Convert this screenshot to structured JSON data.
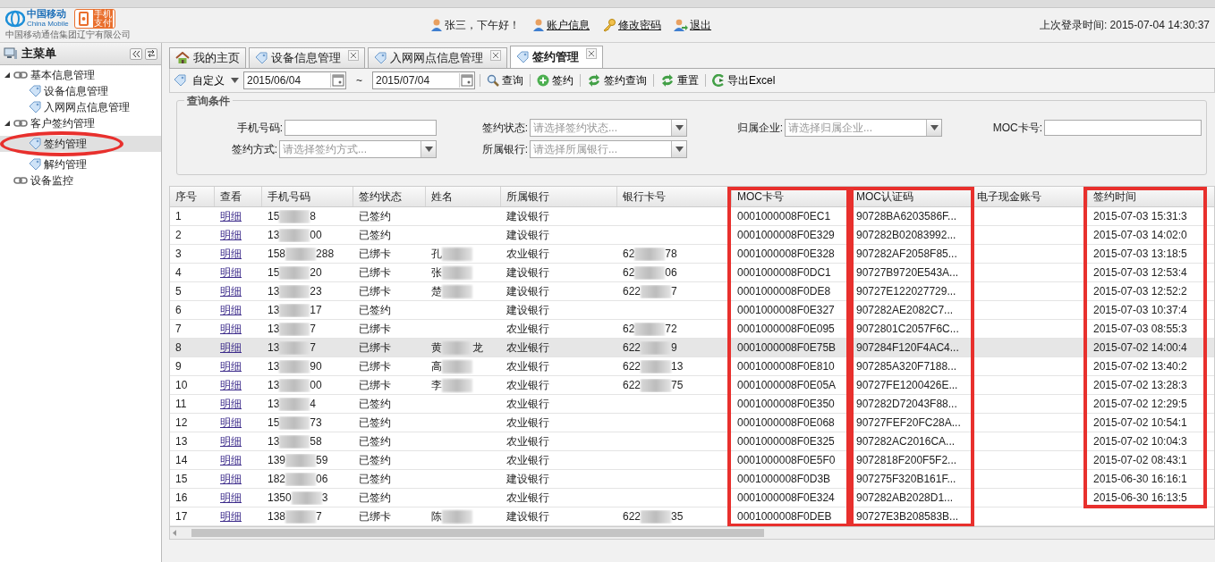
{
  "header": {
    "logo_cn": "中国移动",
    "logo_en": "China Mobile",
    "company": "中国移动通信集团辽宁有限公司",
    "pay_logo": "手机支付",
    "greeting": "张三，下午好！",
    "links": [
      "账户信息",
      "修改密码",
      "退出"
    ],
    "last_login": "上次登录时间: 2015-07-04 14:30:37"
  },
  "sidebar": {
    "title": "主菜单",
    "tree": [
      {
        "label": "基本信息管理",
        "expanded": true,
        "children": [
          {
            "label": "设备信息管理",
            "selected": false,
            "circled": false
          },
          {
            "label": "入网网点信息管理",
            "selected": false,
            "circled": false
          }
        ]
      },
      {
        "label": "客户签约管理",
        "expanded": true,
        "children": [
          {
            "label": "签约管理",
            "selected": true,
            "circled": true
          },
          {
            "label": "解约管理",
            "selected": false,
            "circled": false
          }
        ]
      },
      {
        "label": "设备监控",
        "expanded": false
      }
    ]
  },
  "tabs": [
    {
      "label": "我的主页",
      "kind": "home",
      "closable": false,
      "selected": false
    },
    {
      "label": "设备信息管理",
      "kind": "page",
      "closable": true,
      "selected": false
    },
    {
      "label": "入网网点信息管理",
      "kind": "page",
      "closable": true,
      "selected": false
    },
    {
      "label": "签约管理",
      "kind": "page",
      "closable": true,
      "selected": true
    }
  ],
  "toolbar": {
    "range": "自定义",
    "date_from": "2015/06/04",
    "separator": "~",
    "date_to": "2015/07/04",
    "buttons": [
      {
        "label": "查询",
        "kind": "search"
      },
      {
        "label": "签约",
        "kind": "add"
      },
      {
        "label": "签约查询",
        "kind": "refresh"
      },
      {
        "label": "重置",
        "kind": "refresh"
      },
      {
        "label": "导出Excel",
        "kind": "export"
      }
    ]
  },
  "query": {
    "legend": "查询条件",
    "rows": [
      [
        {
          "label": "手机号码:",
          "kind": "input"
        },
        {
          "label": "签约状态:",
          "kind": "select",
          "placeholder": "请选择签约状态..."
        },
        {
          "label": "归属企业:",
          "kind": "select",
          "placeholder": "请选择归属企业..."
        },
        {
          "label": "MOC卡号:",
          "kind": "input"
        }
      ],
      [
        {
          "label": "签约方式:",
          "kind": "select",
          "placeholder": "请选择签约方式..."
        },
        {
          "label": "所属银行:",
          "kind": "select",
          "placeholder": "请选择所属银行..."
        }
      ]
    ]
  },
  "table": {
    "columns": [
      {
        "label": "序号",
        "boxed": false
      },
      {
        "label": "查看",
        "boxed": false
      },
      {
        "label": "手机号码",
        "boxed": false
      },
      {
        "label": "签约状态",
        "boxed": false
      },
      {
        "label": "姓名",
        "boxed": false
      },
      {
        "label": "所属银行",
        "boxed": false
      },
      {
        "label": "银行卡号",
        "boxed": false
      },
      {
        "label": "MOC卡号",
        "boxed": true
      },
      {
        "label": "MOC认证码",
        "boxed": true
      },
      {
        "label": "电子现金账号",
        "boxed": false
      },
      {
        "label": "签约时间",
        "boxed": true
      }
    ],
    "rows": [
      {
        "no": "1",
        "view": "明细",
        "phone": [
          "15",
          "8"
        ],
        "status": "已签约",
        "name": [],
        "bank": "建设银行",
        "card": [],
        "moc_card": "0001000008F0EC1",
        "moc_code": "90728BA6203586F...",
        "time": "2015-07-03 15:31:3",
        "selected": false
      },
      {
        "no": "2",
        "view": "明细",
        "phone": [
          "13",
          "00"
        ],
        "status": "已签约",
        "name": [],
        "bank": "建设银行",
        "card": [],
        "moc_card": "0001000008F0E329",
        "moc_code": "907282B02083992...",
        "time": "2015-07-03 14:02:0",
        "selected": false
      },
      {
        "no": "3",
        "view": "明细",
        "phone": [
          "158",
          "288"
        ],
        "status": "已绑卡",
        "name": [
          "孔"
        ],
        "bank": "农业银行",
        "card": [
          "62",
          "78"
        ],
        "moc_card": "0001000008F0E328",
        "moc_code": "907282AF2058F85...",
        "time": "2015-07-03 13:18:5",
        "selected": false
      },
      {
        "no": "4",
        "view": "明细",
        "phone": [
          "15",
          "20"
        ],
        "status": "已绑卡",
        "name": [
          "张"
        ],
        "bank": "建设银行",
        "card": [
          "62",
          "06"
        ],
        "moc_card": "0001000008F0DC1",
        "moc_code": "90727B9720E543A...",
        "time": "2015-07-03 12:53:4",
        "selected": false
      },
      {
        "no": "5",
        "view": "明细",
        "phone": [
          "13",
          "23"
        ],
        "status": "已绑卡",
        "name": [
          "楚"
        ],
        "bank": "建设银行",
        "card": [
          "622",
          "7"
        ],
        "moc_card": "0001000008F0DE8",
        "moc_code": "90727E122027729...",
        "time": "2015-07-03 12:52:2",
        "selected": false
      },
      {
        "no": "6",
        "view": "明细",
        "phone": [
          "13",
          "17"
        ],
        "status": "已签约",
        "name": [],
        "bank": "建设银行",
        "card": [],
        "moc_card": "0001000008F0E327",
        "moc_code": "907282AE2082C7...",
        "time": "2015-07-03 10:37:4",
        "selected": false
      },
      {
        "no": "7",
        "view": "明细",
        "phone": [
          "13",
          "7"
        ],
        "status": "已绑卡",
        "name": [],
        "bank": "农业银行",
        "card": [
          "62",
          "72"
        ],
        "moc_card": "0001000008F0E095",
        "moc_code": "9072801C2057F6C...",
        "time": "2015-07-03 08:55:3",
        "selected": false
      },
      {
        "no": "8",
        "view": "明细",
        "phone": [
          "13",
          "7"
        ],
        "status": "已绑卡",
        "name": [
          "黄",
          "龙"
        ],
        "bank": "农业银行",
        "card": [
          "622",
          "9"
        ],
        "moc_card": "0001000008F0E75B",
        "moc_code": "907284F120F4AC4...",
        "time": "2015-07-02 14:00:4",
        "selected": true
      },
      {
        "no": "9",
        "view": "明细",
        "phone": [
          "13",
          "90"
        ],
        "status": "已绑卡",
        "name": [
          "高"
        ],
        "bank": "农业银行",
        "card": [
          "622",
          "13"
        ],
        "moc_card": "0001000008F0E810",
        "moc_code": "907285A320F7188...",
        "time": "2015-07-02 13:40:2",
        "selected": false
      },
      {
        "no": "10",
        "view": "明细",
        "phone": [
          "13",
          "00"
        ],
        "status": "已绑卡",
        "name": [
          "李"
        ],
        "bank": "农业银行",
        "card": [
          "622",
          "75"
        ],
        "moc_card": "0001000008F0E05A",
        "moc_code": "90727FE1200426E...",
        "time": "2015-07-02 13:28:3",
        "selected": false
      },
      {
        "no": "11",
        "view": "明细",
        "phone": [
          "13",
          "4"
        ],
        "status": "已签约",
        "name": [],
        "bank": "农业银行",
        "card": [],
        "moc_card": "0001000008F0E350",
        "moc_code": "907282D72043F88...",
        "time": "2015-07-02 12:29:5",
        "selected": false
      },
      {
        "no": "12",
        "view": "明细",
        "phone": [
          "15",
          "73"
        ],
        "status": "已签约",
        "name": [],
        "bank": "农业银行",
        "card": [],
        "moc_card": "0001000008F0E068",
        "moc_code": "90727FEF20FC28A...",
        "time": "2015-07-02 10:54:1",
        "selected": false
      },
      {
        "no": "13",
        "view": "明细",
        "phone": [
          "13",
          "58"
        ],
        "status": "已签约",
        "name": [],
        "bank": "农业银行",
        "card": [],
        "moc_card": "0001000008F0E325",
        "moc_code": "907282AC2016CA...",
        "time": "2015-07-02 10:04:3",
        "selected": false
      },
      {
        "no": "14",
        "view": "明细",
        "phone": [
          "139",
          "59"
        ],
        "status": "已签约",
        "name": [],
        "bank": "农业银行",
        "card": [],
        "moc_card": "0001000008F0E5F0",
        "moc_code": "9072818F200F5F2...",
        "time": "2015-07-02 08:43:1",
        "selected": false
      },
      {
        "no": "15",
        "view": "明细",
        "phone": [
          "182",
          "06"
        ],
        "status": "已签约",
        "name": [],
        "bank": "建设银行",
        "card": [],
        "moc_card": "0001000008F0D3B",
        "moc_code": "907275F320B161F...",
        "time": "2015-06-30 16:16:1",
        "selected": false
      },
      {
        "no": "16",
        "view": "明细",
        "phone": [
          "1350",
          "3"
        ],
        "status": "已签约",
        "name": [],
        "bank": "农业银行",
        "card": [],
        "moc_card": "0001000008F0E324",
        "moc_code": "907282AB2028D1...",
        "time": "2015-06-30 16:13:5",
        "selected": false
      },
      {
        "no": "17",
        "view": "明细",
        "phone": [
          "138",
          "7"
        ],
        "status": "已绑卡",
        "name": [
          "陈"
        ],
        "bank": "建设银行",
        "card": [
          "622",
          "35"
        ],
        "moc_card": "0001000008F0DEB",
        "moc_code": "90727E3B208583B...",
        "selected": false
      }
    ]
  }
}
